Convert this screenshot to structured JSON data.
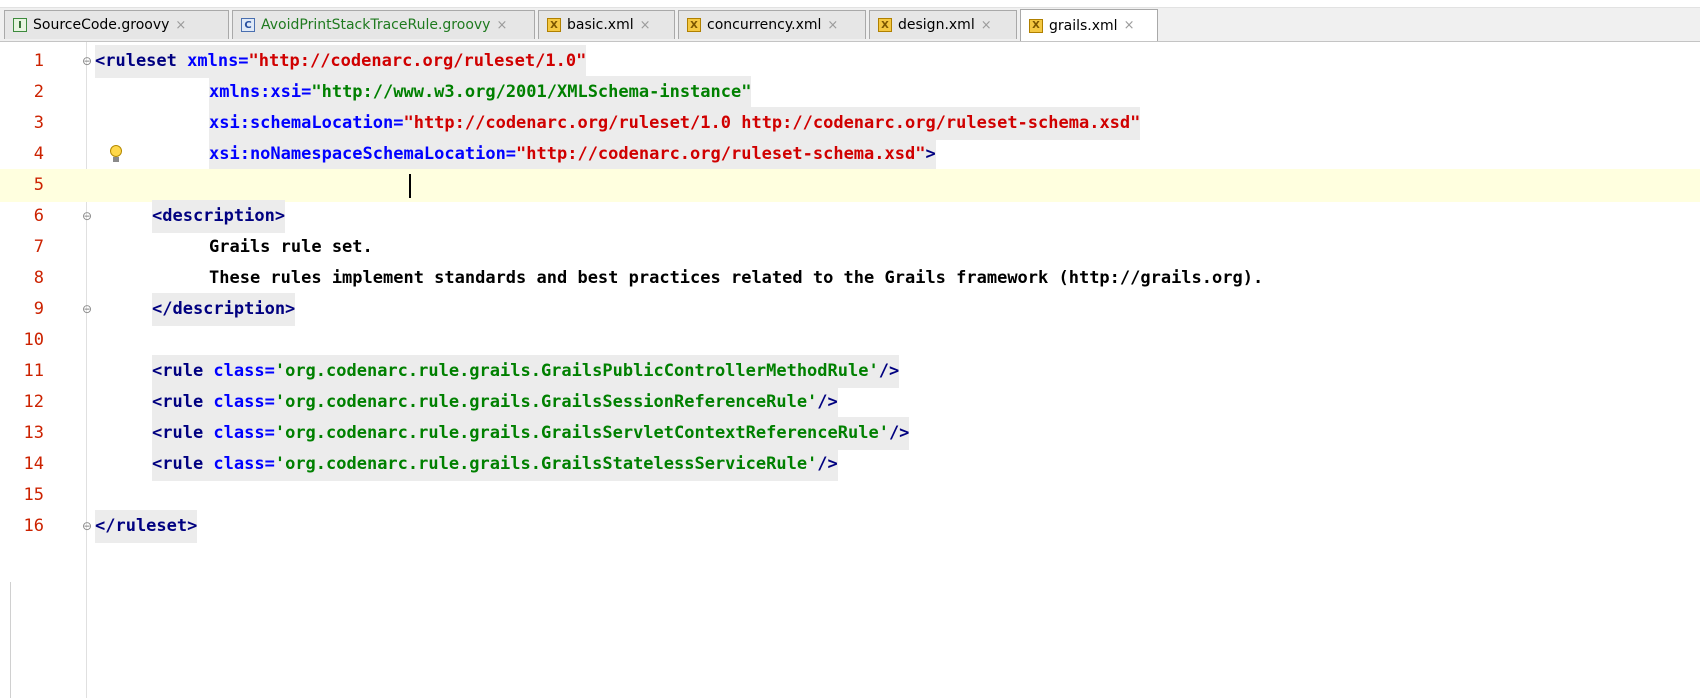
{
  "tabs": [
    {
      "label": "SourceCode.groovy",
      "icon": "groovy-file-icon",
      "icon_glyph": "I"
    },
    {
      "label": "AvoidPrintStackTraceRule.groovy",
      "icon": "groovy-class-icon",
      "icon_glyph": "C"
    },
    {
      "label": "basic.xml",
      "icon": "xml-file-icon",
      "icon_glyph": "X"
    },
    {
      "label": "concurrency.xml",
      "icon": "xml-file-icon",
      "icon_glyph": "X"
    },
    {
      "label": "design.xml",
      "icon": "xml-file-icon",
      "icon_glyph": "X"
    },
    {
      "label": "grails.xml",
      "icon": "xml-file-icon",
      "icon_glyph": "X"
    }
  ],
  "active_tab": "grails.xml",
  "close_glyph": "×",
  "gutter": {
    "line_numbers": [
      "1",
      "2",
      "3",
      "4",
      "5",
      "6",
      "7",
      "8",
      "9",
      "10",
      "11",
      "12",
      "13",
      "14",
      "15",
      "16"
    ],
    "fold_open_glyph": "⊖",
    "fold_close_glyph": "⊖"
  },
  "code": {
    "l1_a": "<ruleset ",
    "l1_b": "xmlns=",
    "l1_c": "\"http://codenarc.org/ruleset/1.0\"",
    "l2_a": "xmlns:xsi=",
    "l2_b": "\"http://www.w3.org/2001/XMLSchema-instance\"",
    "l3_a": "xsi:schemaLocation=",
    "l3_b": "\"http://codenarc.org/ruleset/1.0 http://codenarc.org/ruleset-schema.xsd\"",
    "l4_a": "xsi:noNamespaceSchemaLocation=",
    "l4_b": "\"http://codenarc.org/ruleset-schema.xsd\"",
    "l4_c": ">",
    "l6": "<description>",
    "l7": "Grails rule set.",
    "l8": "These rules implement standards and best practices related to the Grails framework (http://grails.org).",
    "l9": "</description>",
    "rule_open": "<rule ",
    "rule_attr": "class=",
    "rule_close": "/>",
    "l11_val": "'org.codenarc.rule.grails.GrailsPublicControllerMethodRule'",
    "l12_val": "'org.codenarc.rule.grails.GrailsSessionReferenceRule'",
    "l13_val": "'org.codenarc.rule.grails.GrailsServletContextReferenceRule'",
    "l14_val": "'org.codenarc.rule.grails.GrailsStatelessServiceRule'",
    "l16": "</ruleset>"
  },
  "colors": {
    "tag": "#000080",
    "attribute": "#0000ff",
    "string": "#008000",
    "url_string": "#d00000",
    "line_number": "#cc2200",
    "current_line": "#ffffdf"
  }
}
